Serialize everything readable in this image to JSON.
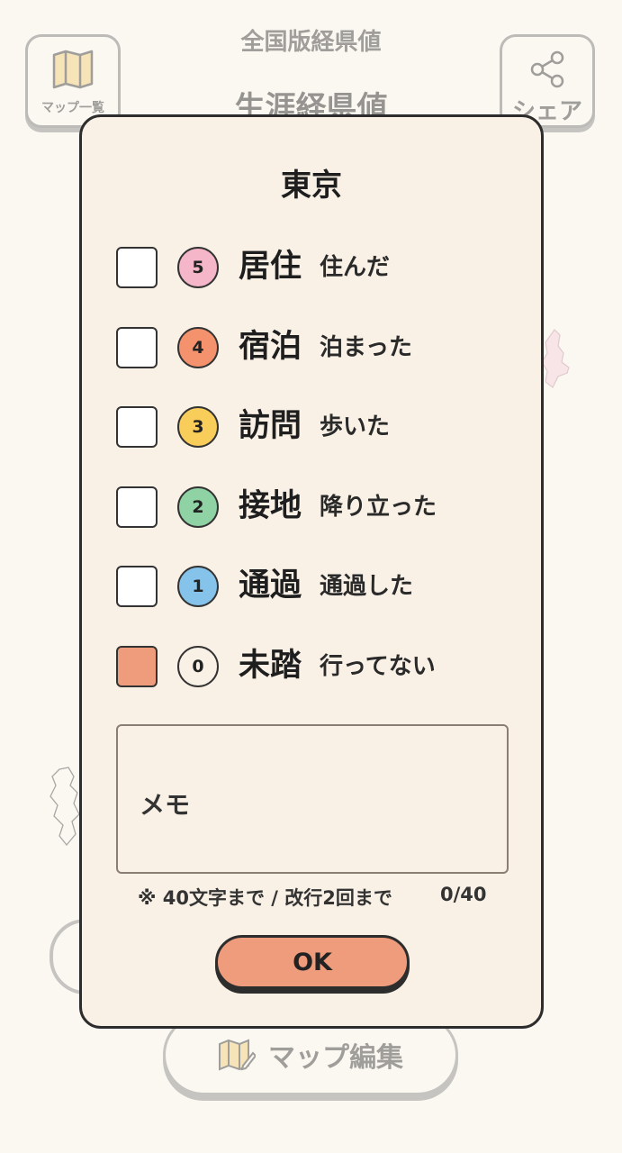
{
  "background": {
    "header_subtitle": "全国版経県値",
    "header_title": "生涯経県値",
    "map_list_label": "マップ一覧",
    "share_label": "シェア",
    "edit_map_label": "マップ編集",
    "icons": [
      "map-icon",
      "share-icon",
      "map-edit-icon"
    ]
  },
  "dialog": {
    "title": "東京",
    "options": [
      {
        "level": "5",
        "name": "居住",
        "desc": "住んだ",
        "color": "#f4b6c8",
        "checked": false
      },
      {
        "level": "4",
        "name": "宿泊",
        "desc": "泊まった",
        "color": "#f4926e",
        "checked": false
      },
      {
        "level": "3",
        "name": "訪問",
        "desc": "歩いた",
        "color": "#f9cd5a",
        "checked": false
      },
      {
        "level": "2",
        "name": "接地",
        "desc": "降り立った",
        "color": "#8fd3a4",
        "checked": false
      },
      {
        "level": "1",
        "name": "通過",
        "desc": "通過した",
        "color": "#86c3ea",
        "checked": false
      },
      {
        "level": "0",
        "name": "未踏",
        "desc": "行ってない",
        "color": "#faf1e6",
        "checked": true
      }
    ],
    "memo": {
      "placeholder": "メモ",
      "value": "",
      "note": "※ 40文字まで / 改行2回まで",
      "count": "0/40"
    },
    "ok_label": "OK"
  },
  "colors": {
    "accent": "#ef9c7d",
    "dialog_bg": "#faf1e6",
    "page_bg": "#fbf8f1"
  }
}
